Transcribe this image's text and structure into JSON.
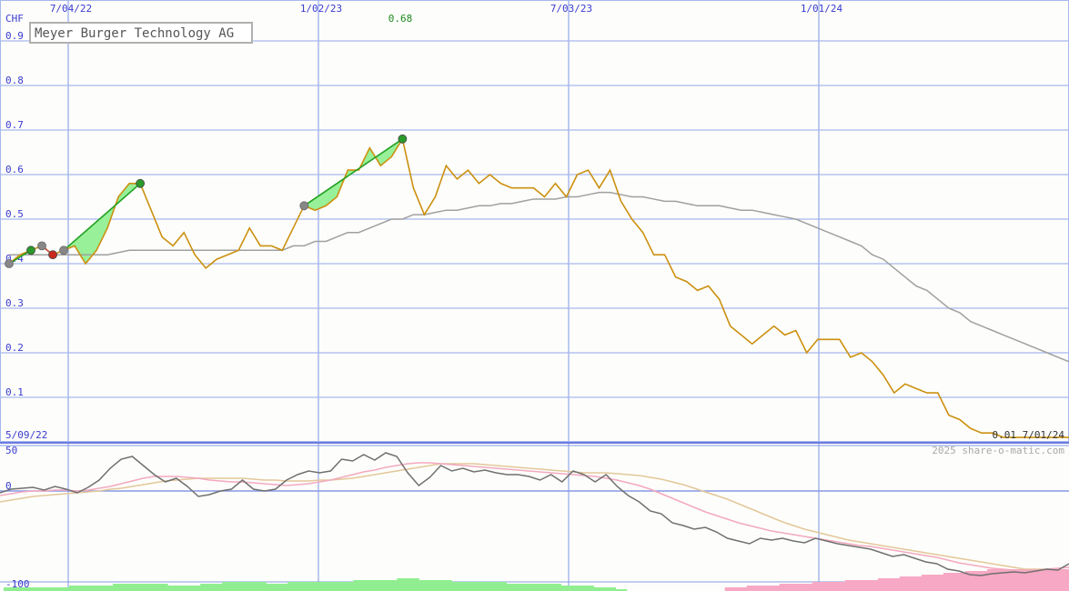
{
  "chart_data": [
    {
      "type": "line",
      "title": "Meyer Burger Technology AG",
      "ylabel": "CHF",
      "ylim": [
        0,
        0.9
      ],
      "ytick_labels": [
        "0.9",
        "0.8",
        "0.7",
        "0.6",
        "0.5",
        "0.4",
        "0.3",
        "0.2",
        "0.1"
      ],
      "xtick_labels": [
        "7/04/22",
        "1/02/23",
        "7/03/23",
        "1/01/24"
      ],
      "start_date_label": "5/09/22",
      "end_label": "0.01 7/01/24",
      "max_label": "0.68",
      "credit": "2025 share-o-matic.com",
      "grid": true,
      "colors": {
        "price": "#cc9010",
        "moving_average": "#a0a0a0",
        "grid": "#a7b7ee",
        "gain_fill": "#98f098",
        "loss_fill": "#f7a8c4",
        "trend_line": "#22a022",
        "trend_point_gain": "#2a9a2a",
        "trend_point_loss": "#c82a1e",
        "trend_point_start": "#888888"
      },
      "series": [
        {
          "key": "price",
          "values": [
            0.4,
            0.42,
            0.43,
            0.44,
            0.42,
            0.43,
            0.44,
            0.4,
            0.43,
            0.48,
            0.55,
            0.58,
            0.58,
            0.52,
            0.46,
            0.44,
            0.47,
            0.42,
            0.39,
            0.41,
            0.42,
            0.43,
            0.48,
            0.44,
            0.44,
            0.43,
            0.48,
            0.53,
            0.52,
            0.53,
            0.55,
            0.61,
            0.61,
            0.66,
            0.62,
            0.64,
            0.68,
            0.57,
            0.51,
            0.55,
            0.62,
            0.59,
            0.61,
            0.58,
            0.6,
            0.58,
            0.57,
            0.57,
            0.57,
            0.55,
            0.58,
            0.55,
            0.6,
            0.61,
            0.57,
            0.61,
            0.54,
            0.5,
            0.47,
            0.42,
            0.42,
            0.37,
            0.36,
            0.34,
            0.35,
            0.32,
            0.26,
            0.24,
            0.22,
            0.24,
            0.26,
            0.24,
            0.25,
            0.2,
            0.23,
            0.23,
            0.23,
            0.19,
            0.2,
            0.18,
            0.15,
            0.11,
            0.13,
            0.12,
            0.11,
            0.11,
            0.06,
            0.05,
            0.03,
            0.02,
            0.02,
            0.01,
            0.01,
            0.01,
            0.01,
            0.01,
            0.01,
            0.01
          ]
        },
        {
          "key": "moving_average",
          "values": [
            0.42,
            0.42,
            0.42,
            0.42,
            0.42,
            0.42,
            0.42,
            0.42,
            0.42,
            0.42,
            0.425,
            0.43,
            0.43,
            0.43,
            0.43,
            0.43,
            0.43,
            0.43,
            0.43,
            0.43,
            0.43,
            0.43,
            0.43,
            0.43,
            0.43,
            0.43,
            0.44,
            0.44,
            0.45,
            0.45,
            0.46,
            0.47,
            0.47,
            0.48,
            0.49,
            0.5,
            0.5,
            0.51,
            0.51,
            0.515,
            0.52,
            0.52,
            0.525,
            0.53,
            0.53,
            0.535,
            0.535,
            0.54,
            0.545,
            0.545,
            0.545,
            0.55,
            0.55,
            0.555,
            0.56,
            0.56,
            0.555,
            0.55,
            0.55,
            0.545,
            0.54,
            0.54,
            0.535,
            0.53,
            0.53,
            0.53,
            0.525,
            0.52,
            0.52,
            0.515,
            0.51,
            0.505,
            0.5,
            0.49,
            0.48,
            0.47,
            0.46,
            0.45,
            0.44,
            0.42,
            0.41,
            0.39,
            0.37,
            0.35,
            0.34,
            0.32,
            0.3,
            0.29,
            0.27,
            0.26,
            0.25,
            0.24,
            0.23,
            0.22,
            0.21,
            0.2,
            0.19,
            0.18
          ]
        }
      ],
      "trend_segments": [
        {
          "from_index": 0,
          "to_index": 2,
          "outcome": "gain"
        },
        {
          "from_index": 3,
          "to_index": 4,
          "outcome": "loss"
        },
        {
          "from_index": 5,
          "to_index": 12,
          "outcome": "gain"
        },
        {
          "from_index": 27,
          "to_index": 36,
          "outcome": "gain"
        }
      ]
    },
    {
      "type": "line",
      "ylim": [
        -100,
        50
      ],
      "ytick_labels": [
        "50",
        "0",
        "-100"
      ],
      "grid": true,
      "colors": {
        "momentum": "#707070",
        "fast_average": "#f3a9c0",
        "slow_average": "#e3c79a",
        "positive_bar": "#90ee90",
        "negative_bar": "#f7a8c4"
      },
      "series": [
        {
          "key": "momentum",
          "values": [
            -2,
            2,
            3,
            4,
            1,
            5,
            2,
            -2,
            4,
            12,
            25,
            35,
            38,
            28,
            18,
            10,
            14,
            5,
            -6,
            -4,
            0,
            2,
            12,
            2,
            0,
            2,
            12,
            18,
            22,
            20,
            22,
            35,
            33,
            40,
            34,
            42,
            38,
            20,
            6,
            15,
            28,
            22,
            25,
            21,
            23,
            20,
            18,
            18,
            16,
            12,
            18,
            10,
            22,
            18,
            10,
            18,
            5,
            -5,
            -12,
            -22,
            -25,
            -35,
            -38,
            -42,
            -40,
            -45,
            -52,
            -55,
            -58,
            -52,
            -54,
            -52,
            -55,
            -57,
            -52,
            -55,
            -58,
            -60,
            -62,
            -64,
            -68,
            -72,
            -70,
            -74,
            -78,
            -80,
            -86,
            -88,
            -92,
            -93,
            -91,
            -90,
            -89,
            -90,
            -88,
            -86,
            -87,
            -80
          ]
        },
        {
          "key": "fast_average",
          "values": [
            -5,
            -3,
            -1,
            0,
            0,
            1,
            1,
            0,
            1,
            3,
            5,
            8,
            11,
            14,
            16,
            16,
            16,
            15,
            14,
            12,
            11,
            10,
            10,
            9,
            8,
            7,
            6,
            7,
            8,
            10,
            12,
            15,
            18,
            21,
            23,
            26,
            28,
            30,
            31,
            31,
            30,
            29,
            28,
            27,
            26,
            25,
            24,
            23,
            22,
            21,
            20,
            19,
            18,
            17,
            16,
            14,
            12,
            9,
            6,
            2,
            -3,
            -8,
            -13,
            -18,
            -23,
            -27,
            -31,
            -35,
            -38,
            -41,
            -44,
            -46,
            -48,
            -50,
            -52,
            -54,
            -56,
            -58,
            -60,
            -61,
            -63,
            -65,
            -67,
            -69,
            -71,
            -73,
            -76,
            -79,
            -81,
            -83,
            -85,
            -86,
            -87,
            -87,
            -87,
            -86,
            -85,
            -84
          ]
        },
        {
          "key": "slow_average",
          "values": [
            -12,
            -10,
            -8,
            -6,
            -5,
            -4,
            -3,
            -2,
            -1,
            0,
            2,
            3,
            5,
            7,
            9,
            11,
            12,
            13,
            14,
            14,
            14,
            14,
            14,
            13,
            12,
            12,
            11,
            11,
            11,
            12,
            12,
            13,
            14,
            16,
            18,
            20,
            22,
            24,
            26,
            28,
            30,
            30,
            30,
            30,
            29,
            28,
            27,
            26,
            25,
            24,
            23,
            22,
            21,
            20,
            20,
            20,
            19,
            18,
            17,
            15,
            13,
            10,
            7,
            3,
            -1,
            -5,
            -9,
            -14,
            -19,
            -24,
            -29,
            -34,
            -38,
            -42,
            -45,
            -48,
            -51,
            -54,
            -56,
            -58,
            -60,
            -62,
            -64,
            -66,
            -68,
            -70,
            -72,
            -74,
            -76,
            -78,
            -80,
            -82,
            -84,
            -86,
            -86,
            -86,
            -85,
            -84
          ]
        }
      ],
      "histogram": [
        4,
        4,
        4,
        4,
        4,
        4,
        6,
        6,
        6,
        6,
        8,
        8,
        8,
        8,
        8,
        6,
        6,
        6,
        8,
        8,
        10,
        10,
        10,
        10,
        8,
        8,
        10,
        10,
        10,
        10,
        10,
        10,
        12,
        12,
        12,
        12,
        14,
        14,
        12,
        12,
        12,
        10,
        10,
        10,
        10,
        10,
        8,
        8,
        8,
        8,
        8,
        6,
        6,
        6,
        4,
        4,
        2,
        0,
        0,
        0,
        0,
        0,
        0,
        0,
        0,
        0,
        -4,
        -4,
        -6,
        -6,
        -6,
        -8,
        -8,
        -8,
        -10,
        -10,
        -10,
        -12,
        -12,
        -12,
        -14,
        -14,
        -16,
        -16,
        -18,
        -18,
        -20,
        -20,
        -22,
        -22,
        -24,
        -24,
        -24,
        -24,
        -24,
        -24,
        -24,
        -24
      ]
    }
  ]
}
